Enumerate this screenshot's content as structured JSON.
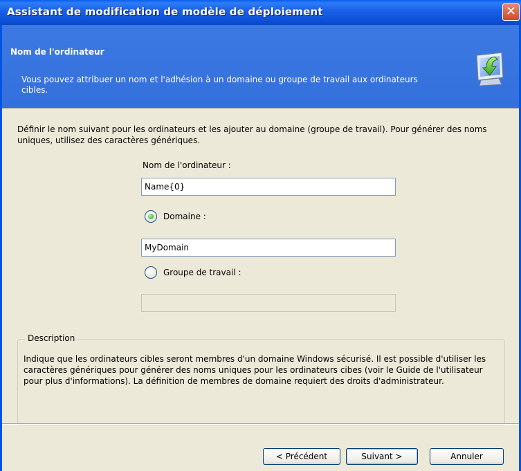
{
  "window": {
    "title": "Assistant de modification de modèle de déploiement",
    "close_glyph": "✕"
  },
  "header": {
    "title": "Nom de l'ordinateur",
    "description": "Vous pouvez attribuer un nom et l'adhésion à un domaine ou groupe de travail aux ordinateurs cibles.",
    "icon": "computer-arrow-icon"
  },
  "content": {
    "intro": "Définir le nom suivant pour les ordinateurs et les ajouter au domaine (groupe de travail). Pour générer des noms uniques, utilisez des caractères génériques.",
    "computer_name": {
      "label": "Nom de l'ordinateur :",
      "value": "Name{0}"
    },
    "domain": {
      "label": "Domaine :",
      "value": "MyDomain",
      "selected": true
    },
    "workgroup": {
      "label": "Groupe de travail :",
      "value": "",
      "selected": false
    },
    "description": {
      "title": "Description",
      "text": "Indique que les ordinateurs cibles seront membres d'un domaine Windows sécurisé. Il est possible d'utiliser les caractères génériques pour générer des noms uniques pour les ordinateurs cibes (voir le Guide de l'utilisateur pour plus d'informations). La définition de membres de domaine requiert des droits d'administrateur."
    }
  },
  "buttons": {
    "previous": "< Précédent",
    "next": "Suivant >",
    "cancel": "Annuler"
  },
  "colors": {
    "titlebar": "#0a5ef0",
    "header": "#3d79e2",
    "dialog_bg": "#ece9d8",
    "radio_selected": "#21a121"
  }
}
